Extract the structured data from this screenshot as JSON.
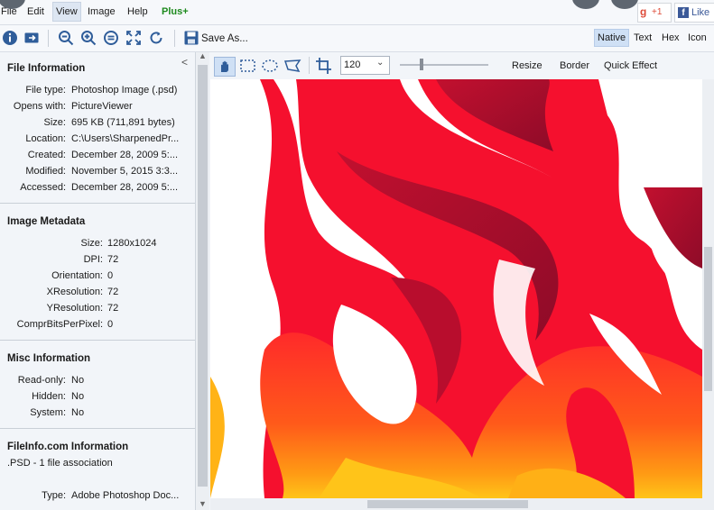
{
  "menubar": {
    "items": [
      "File",
      "Edit",
      "View",
      "Image",
      "Help"
    ],
    "plus": "Plus+",
    "social": {
      "gplus": "+1",
      "like": "Like"
    }
  },
  "toolbar": {
    "save_as": "Save As...",
    "view_modes": [
      "Native",
      "Text",
      "Hex",
      "Icon"
    ]
  },
  "sidebar": {
    "collapse": "<",
    "file_info": {
      "title": "File Information",
      "rows": [
        {
          "label": "File type:",
          "value": "Photoshop Image (.psd)"
        },
        {
          "label": "Opens with:",
          "value": "PictureViewer"
        },
        {
          "label": "Size:",
          "value": "695 KB (711,891 bytes)"
        },
        {
          "label": "Location:",
          "value": "C:\\Users\\SharpenedPr..."
        },
        {
          "label": "Created:",
          "value": "December 28, 2009 5:..."
        },
        {
          "label": "Modified:",
          "value": "November 5, 2015 3:3..."
        },
        {
          "label": "Accessed:",
          "value": "December 28, 2009 5:..."
        }
      ]
    },
    "image_meta": {
      "title": "Image Metadata",
      "rows": [
        {
          "label": "Size:",
          "value": "1280x1024"
        },
        {
          "label": "DPI:",
          "value": "72"
        },
        {
          "label": "Orientation:",
          "value": "0"
        },
        {
          "label": "XResolution:",
          "value": "72"
        },
        {
          "label": "YResolution:",
          "value": "72"
        },
        {
          "label": "ComprBitsPerPixel:",
          "value": "0"
        }
      ]
    },
    "misc_info": {
      "title": "Misc Information",
      "rows": [
        {
          "label": "Read-only:",
          "value": "No"
        },
        {
          "label": "Hidden:",
          "value": "No"
        },
        {
          "label": "System:",
          "value": "No"
        }
      ]
    },
    "fileinfo_com": {
      "title": "FileInfo.com Information",
      "association": ".PSD - 1 file association",
      "rows": [
        {
          "label": "Type:",
          "value": "Adobe Photoshop Doc..."
        }
      ]
    }
  },
  "editor_toolbar": {
    "zoom": "120",
    "actions": [
      "Resize",
      "Border",
      "Quick Effect"
    ]
  },
  "colors": {
    "accent": "#1d8a1d",
    "selected_bg": "#cfe0f5",
    "flame_red": "#f5102e",
    "flame_dark": "#a30d2c",
    "flame_orange": "#ff7a12",
    "flame_yellow": "#ffc419"
  }
}
